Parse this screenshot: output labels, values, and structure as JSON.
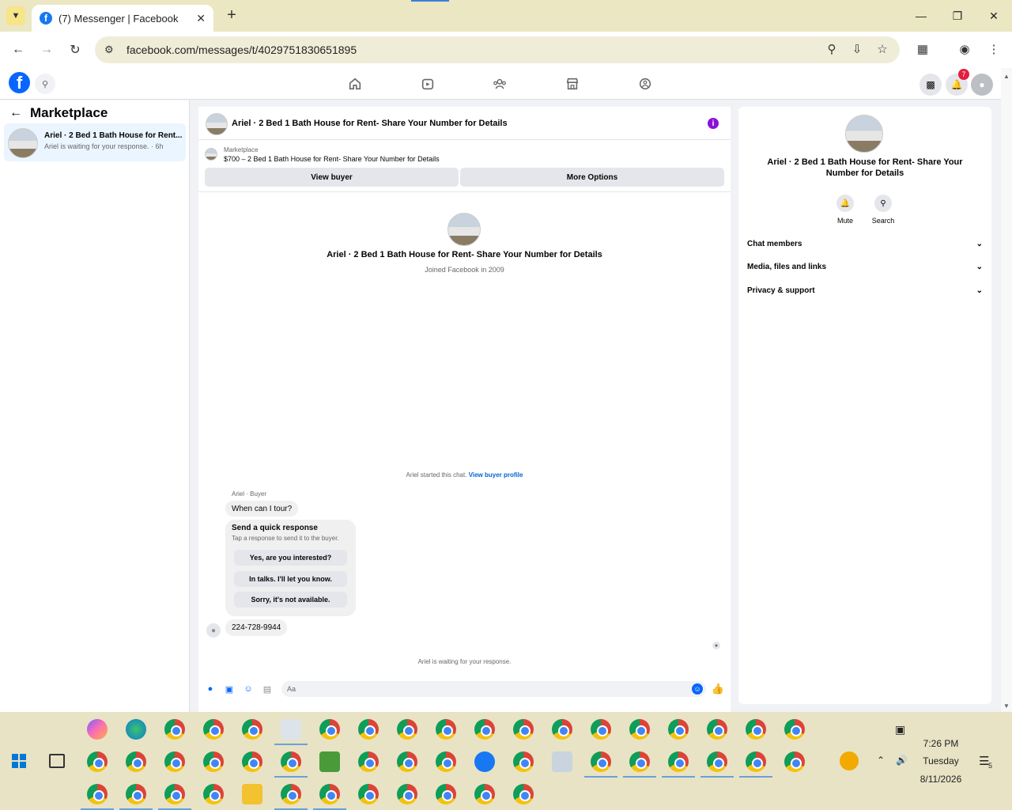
{
  "browser": {
    "tab_title": "(7) Messenger | Facebook",
    "url": "facebook.com/messages/t/4029751830651895"
  },
  "header": {
    "notif_count": "7",
    "nav_icons": [
      "home-icon",
      "video-icon",
      "groups-icon",
      "marketplace-icon",
      "gaming-icon"
    ]
  },
  "left": {
    "title": "Marketplace",
    "conversation": {
      "name": "Ariel · 2 Bed 1 Bath House for Rent...",
      "preview": "Ariel is waiting for your response. · 6h"
    }
  },
  "chat": {
    "title": "Ariel · 2 Bed 1 Bath House for Rent- Share Your Number for Details",
    "marketplace_label": "Marketplace",
    "listing": "$700 – 2 Bed 1 Bath House for Rent- Share Your Number for Details",
    "view_buyer": "View buyer",
    "more_options": "More Options",
    "profile_name": "Ariel · 2 Bed 1 Bath House for Rent- Share Your Number for Details",
    "joined": "Joined Facebook in 2009",
    "started": "Ariel started this chat.",
    "view_profile": "View buyer profile",
    "sender": "Ariel · Buyer",
    "message1": "When can I tour?",
    "quick_title": "Send a quick response",
    "quick_sub": "Tap a response to send it to the buyer.",
    "quick_replies": [
      "Yes, are you interested?",
      "In talks. I'll let you know.",
      "Sorry, it's not available."
    ],
    "message2": "224-728-9944",
    "waiting": "Ariel is waiting for your response.",
    "input_placeholder": "Aa"
  },
  "right": {
    "name": "Ariel · 2 Bed 1 Bath House for Rent- Share Your Number for Details",
    "mute": "Mute",
    "search": "Search",
    "sections": [
      "Chat members",
      "Media, files and links",
      "Privacy & support"
    ]
  },
  "taskbar": {
    "time": "7:26 PM",
    "day": "Tuesday",
    "date": "8/11/2026",
    "notif": "5"
  }
}
